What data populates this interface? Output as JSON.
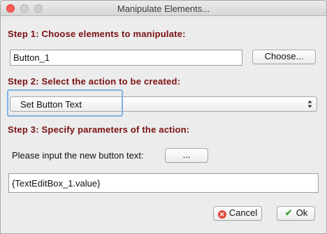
{
  "window": {
    "title": "Manipulate Elements..."
  },
  "step1": {
    "label": "Step 1: Choose elements to manipulate:",
    "element_value": "Button_1",
    "choose_label": "Choose..."
  },
  "step2": {
    "label": "Step 2: Select the action to be created:",
    "selected_action": "Set Button Text"
  },
  "step3": {
    "label": "Step 3: Specify parameters of the action:",
    "prompt": "Please input the new button text:",
    "ellipsis_label": "...",
    "text_value": "{TextEditBox_1.value}"
  },
  "footer": {
    "cancel_label": "Cancel",
    "ok_label": "Ok"
  },
  "colors": {
    "step_label": "#7a1010",
    "focus_ring": "#7fb2e5",
    "close_light": "#fc5b57"
  },
  "icons": {
    "cancel": "x-circle-icon",
    "ok": "checkmark-icon"
  }
}
